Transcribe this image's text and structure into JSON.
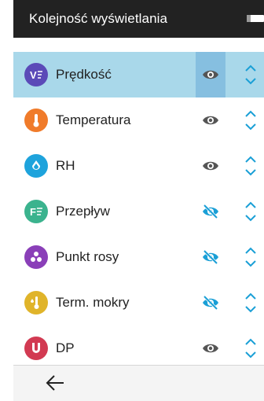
{
  "header": {
    "title": "Kolejność wyświetlania",
    "battery_icon": "battery-icon"
  },
  "colors": {
    "header_bg": "#222222",
    "selected_row": "#a9d8ea",
    "selected_eye_cell": "#86bfe0",
    "accent_blue": "#1a9fd6",
    "eye_visible": "#555555"
  },
  "items": [
    {
      "label": "Prędkość",
      "icon": "velocity-icon",
      "icon_color": "#5b4ab8",
      "visible": true,
      "selected": true
    },
    {
      "label": "Temperatura",
      "icon": "thermometer-icon",
      "icon_color": "#f07b2a",
      "visible": true,
      "selected": false
    },
    {
      "label": "RH",
      "icon": "humidity-drop-icon",
      "icon_color": "#1ea3dc",
      "visible": true,
      "selected": false
    },
    {
      "label": "Przepływ",
      "icon": "flow-icon",
      "icon_color": "#3bb38e",
      "visible": false,
      "selected": false
    },
    {
      "label": "Punkt rosy",
      "icon": "dew-drops-icon",
      "icon_color": "#8a3fb8",
      "visible": false,
      "selected": false
    },
    {
      "label": "Term. mokry",
      "icon": "wet-bulb-icon",
      "icon_color": "#e0b42a",
      "visible": false,
      "selected": false
    },
    {
      "label": "DP",
      "icon": "pressure-icon",
      "icon_color": "#d23a52",
      "visible": true,
      "selected": false
    }
  ],
  "footer": {
    "back_icon": "back-arrow-icon"
  }
}
